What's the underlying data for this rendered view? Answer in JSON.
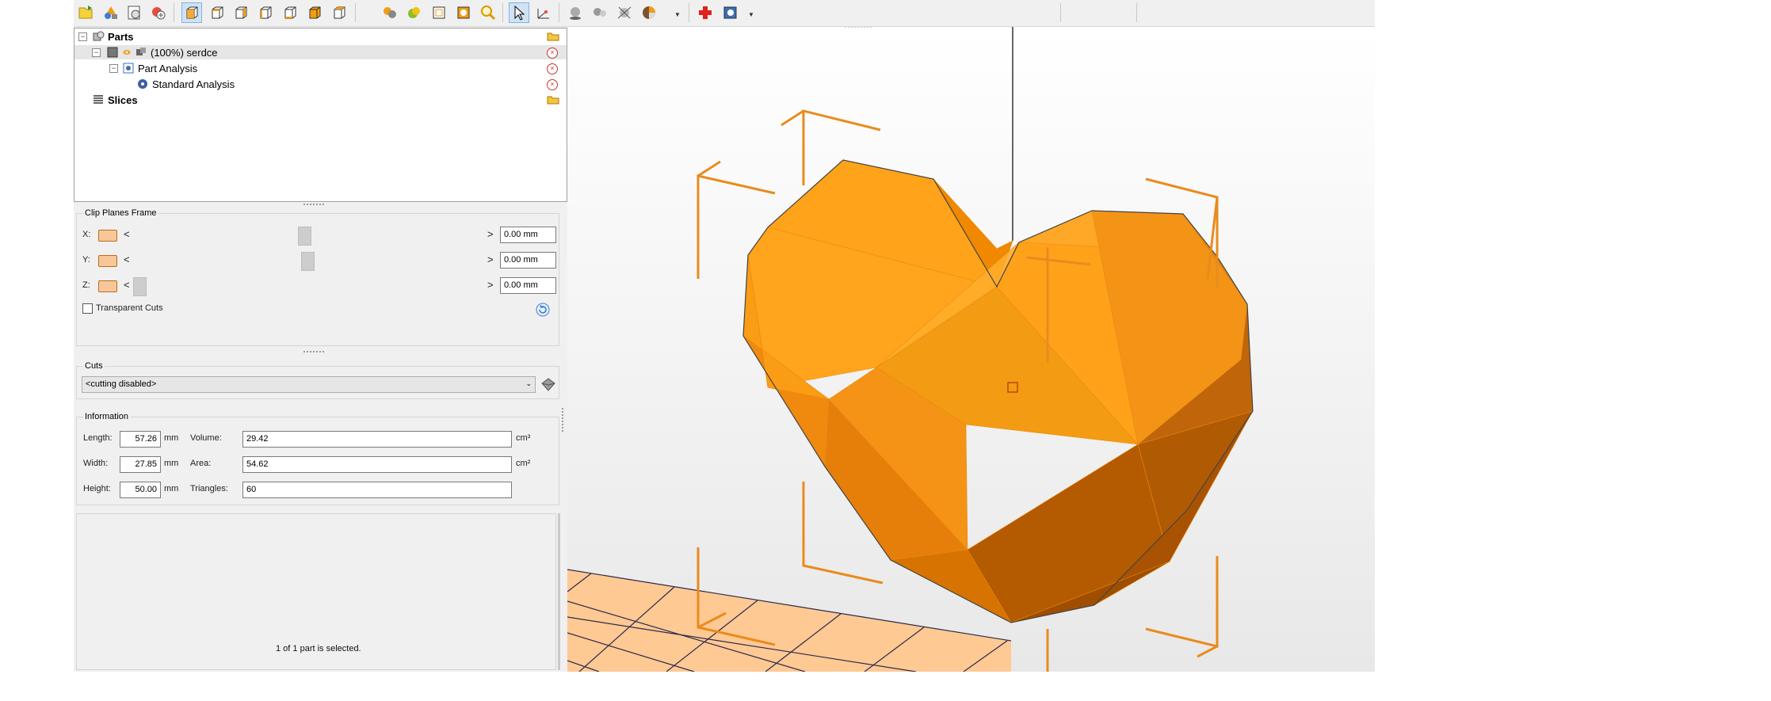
{
  "toolbar": {
    "buttons": [
      "load-part-icon",
      "add-shape-icon",
      "report-icon",
      "add-support-icon",
      "view-default-icon",
      "view-front-icon",
      "view-back-icon",
      "view-left-icon",
      "view-right-icon",
      "view-top-icon",
      "view-bottom-icon",
      "show-all-icon",
      "color-icon",
      "wireframe-icon",
      "fit-icon",
      "zoom-icon",
      "select-icon",
      "measure-icon",
      "sphere-icon",
      "spheres-icon",
      "axes-icon",
      "pie-menu-icon",
      "add-red-cross-icon",
      "analysis-icon"
    ]
  },
  "tree": {
    "items": [
      {
        "label": "Parts",
        "bold": true
      },
      {
        "label": "(100%) serdce",
        "bold": false
      },
      {
        "label": "Part Analysis",
        "bold": false
      },
      {
        "label": "Standard Analysis",
        "bold": false
      },
      {
        "label": "Slices",
        "bold": true
      }
    ]
  },
  "clip_planes": {
    "title": "Clip Planes Frame",
    "rows": [
      {
        "axis": "X:",
        "value": "0.00 mm",
        "position": 0.4
      },
      {
        "axis": "Y:",
        "value": "0.00 mm",
        "position": 0.41
      },
      {
        "axis": "Z:",
        "value": "0.00 mm",
        "position": 0.0
      }
    ],
    "left_arrow": "<",
    "right_arrow": ">",
    "transparent_label": "Transparent Cuts"
  },
  "cuts": {
    "title": "Cuts",
    "selected": "<cutting disabled>"
  },
  "information": {
    "title": "Information",
    "length_label": "Length:",
    "length": "57.26",
    "width_label": "Width:",
    "width": "27.85",
    "height_label": "Height:",
    "height": "50.00",
    "unit_mm": "mm",
    "volume_label": "Volume:",
    "volume": "29.42",
    "area_label": "Area:",
    "area": "54.62",
    "triangles_label": "Triangles:",
    "triangles": "60",
    "unit_cm3": "cm³",
    "unit_cm2": "cm²"
  },
  "status": "1 of 1 part is selected.",
  "colors": {
    "accent": "#f39c12",
    "bbox": "#e98b1e",
    "heart_light": "#ffa41c",
    "heart_dark": "#b85a00",
    "platform": "#ffc994"
  }
}
